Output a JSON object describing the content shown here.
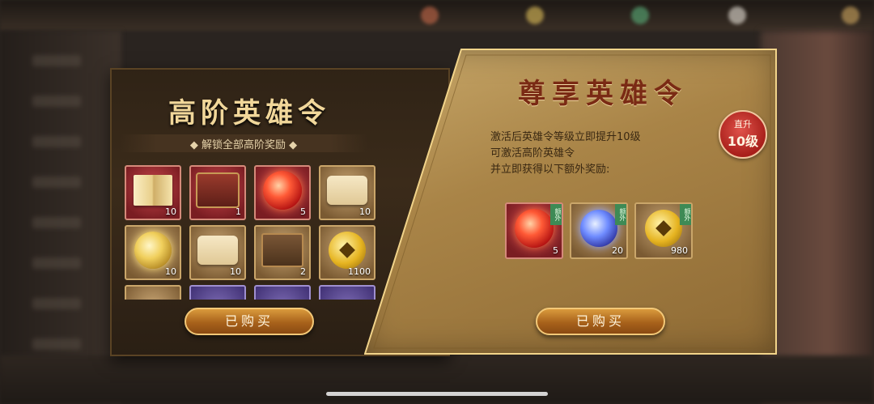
{
  "left_panel": {
    "title": "高阶英雄令",
    "subtitle": "◆ 解锁全部高阶奖励 ◆",
    "rewards": [
      {
        "icon": "scroll-book-icon",
        "count": "10",
        "frame": "red"
      },
      {
        "icon": "treasure-chest-icon",
        "count": "1",
        "frame": "red"
      },
      {
        "icon": "red-orb-icon",
        "count": "5",
        "frame": "red"
      },
      {
        "icon": "paper-scroll-icon",
        "count": "10",
        "frame": "gold"
      },
      {
        "icon": "gold-orb-icon",
        "count": "10",
        "frame": "gold"
      },
      {
        "icon": "map-scroll-icon",
        "count": "10",
        "frame": "gold"
      },
      {
        "icon": "mystery-box-icon",
        "count": "2",
        "frame": "gold"
      },
      {
        "icon": "gold-coin-icon",
        "count": "1100",
        "frame": "gold"
      },
      {
        "icon": "orb-icon",
        "count": "",
        "frame": "gold"
      },
      {
        "icon": "item-icon",
        "count": "",
        "frame": "purple"
      },
      {
        "icon": "item-icon",
        "count": "",
        "frame": "purple"
      },
      {
        "icon": "book-icon",
        "count": "",
        "frame": "purple"
      }
    ],
    "button_label": "已购买"
  },
  "right_panel": {
    "title": "尊享英雄令",
    "description": [
      "激活后英雄令等级立即提升10级",
      "可激活高阶英雄令",
      "并立即获得以下额外奖励:"
    ],
    "badge": {
      "line1": "直升",
      "line2": "10级"
    },
    "bonus_rewards": [
      {
        "icon": "red-orb-icon",
        "count": "5",
        "tag": "额外",
        "frame": "red"
      },
      {
        "icon": "blue-orb-icon",
        "count": "20",
        "tag": "额外",
        "frame": "gold"
      },
      {
        "icon": "gold-coin-icon",
        "count": "980",
        "tag": "额外",
        "frame": "gold"
      }
    ],
    "button_label": "已购买"
  }
}
